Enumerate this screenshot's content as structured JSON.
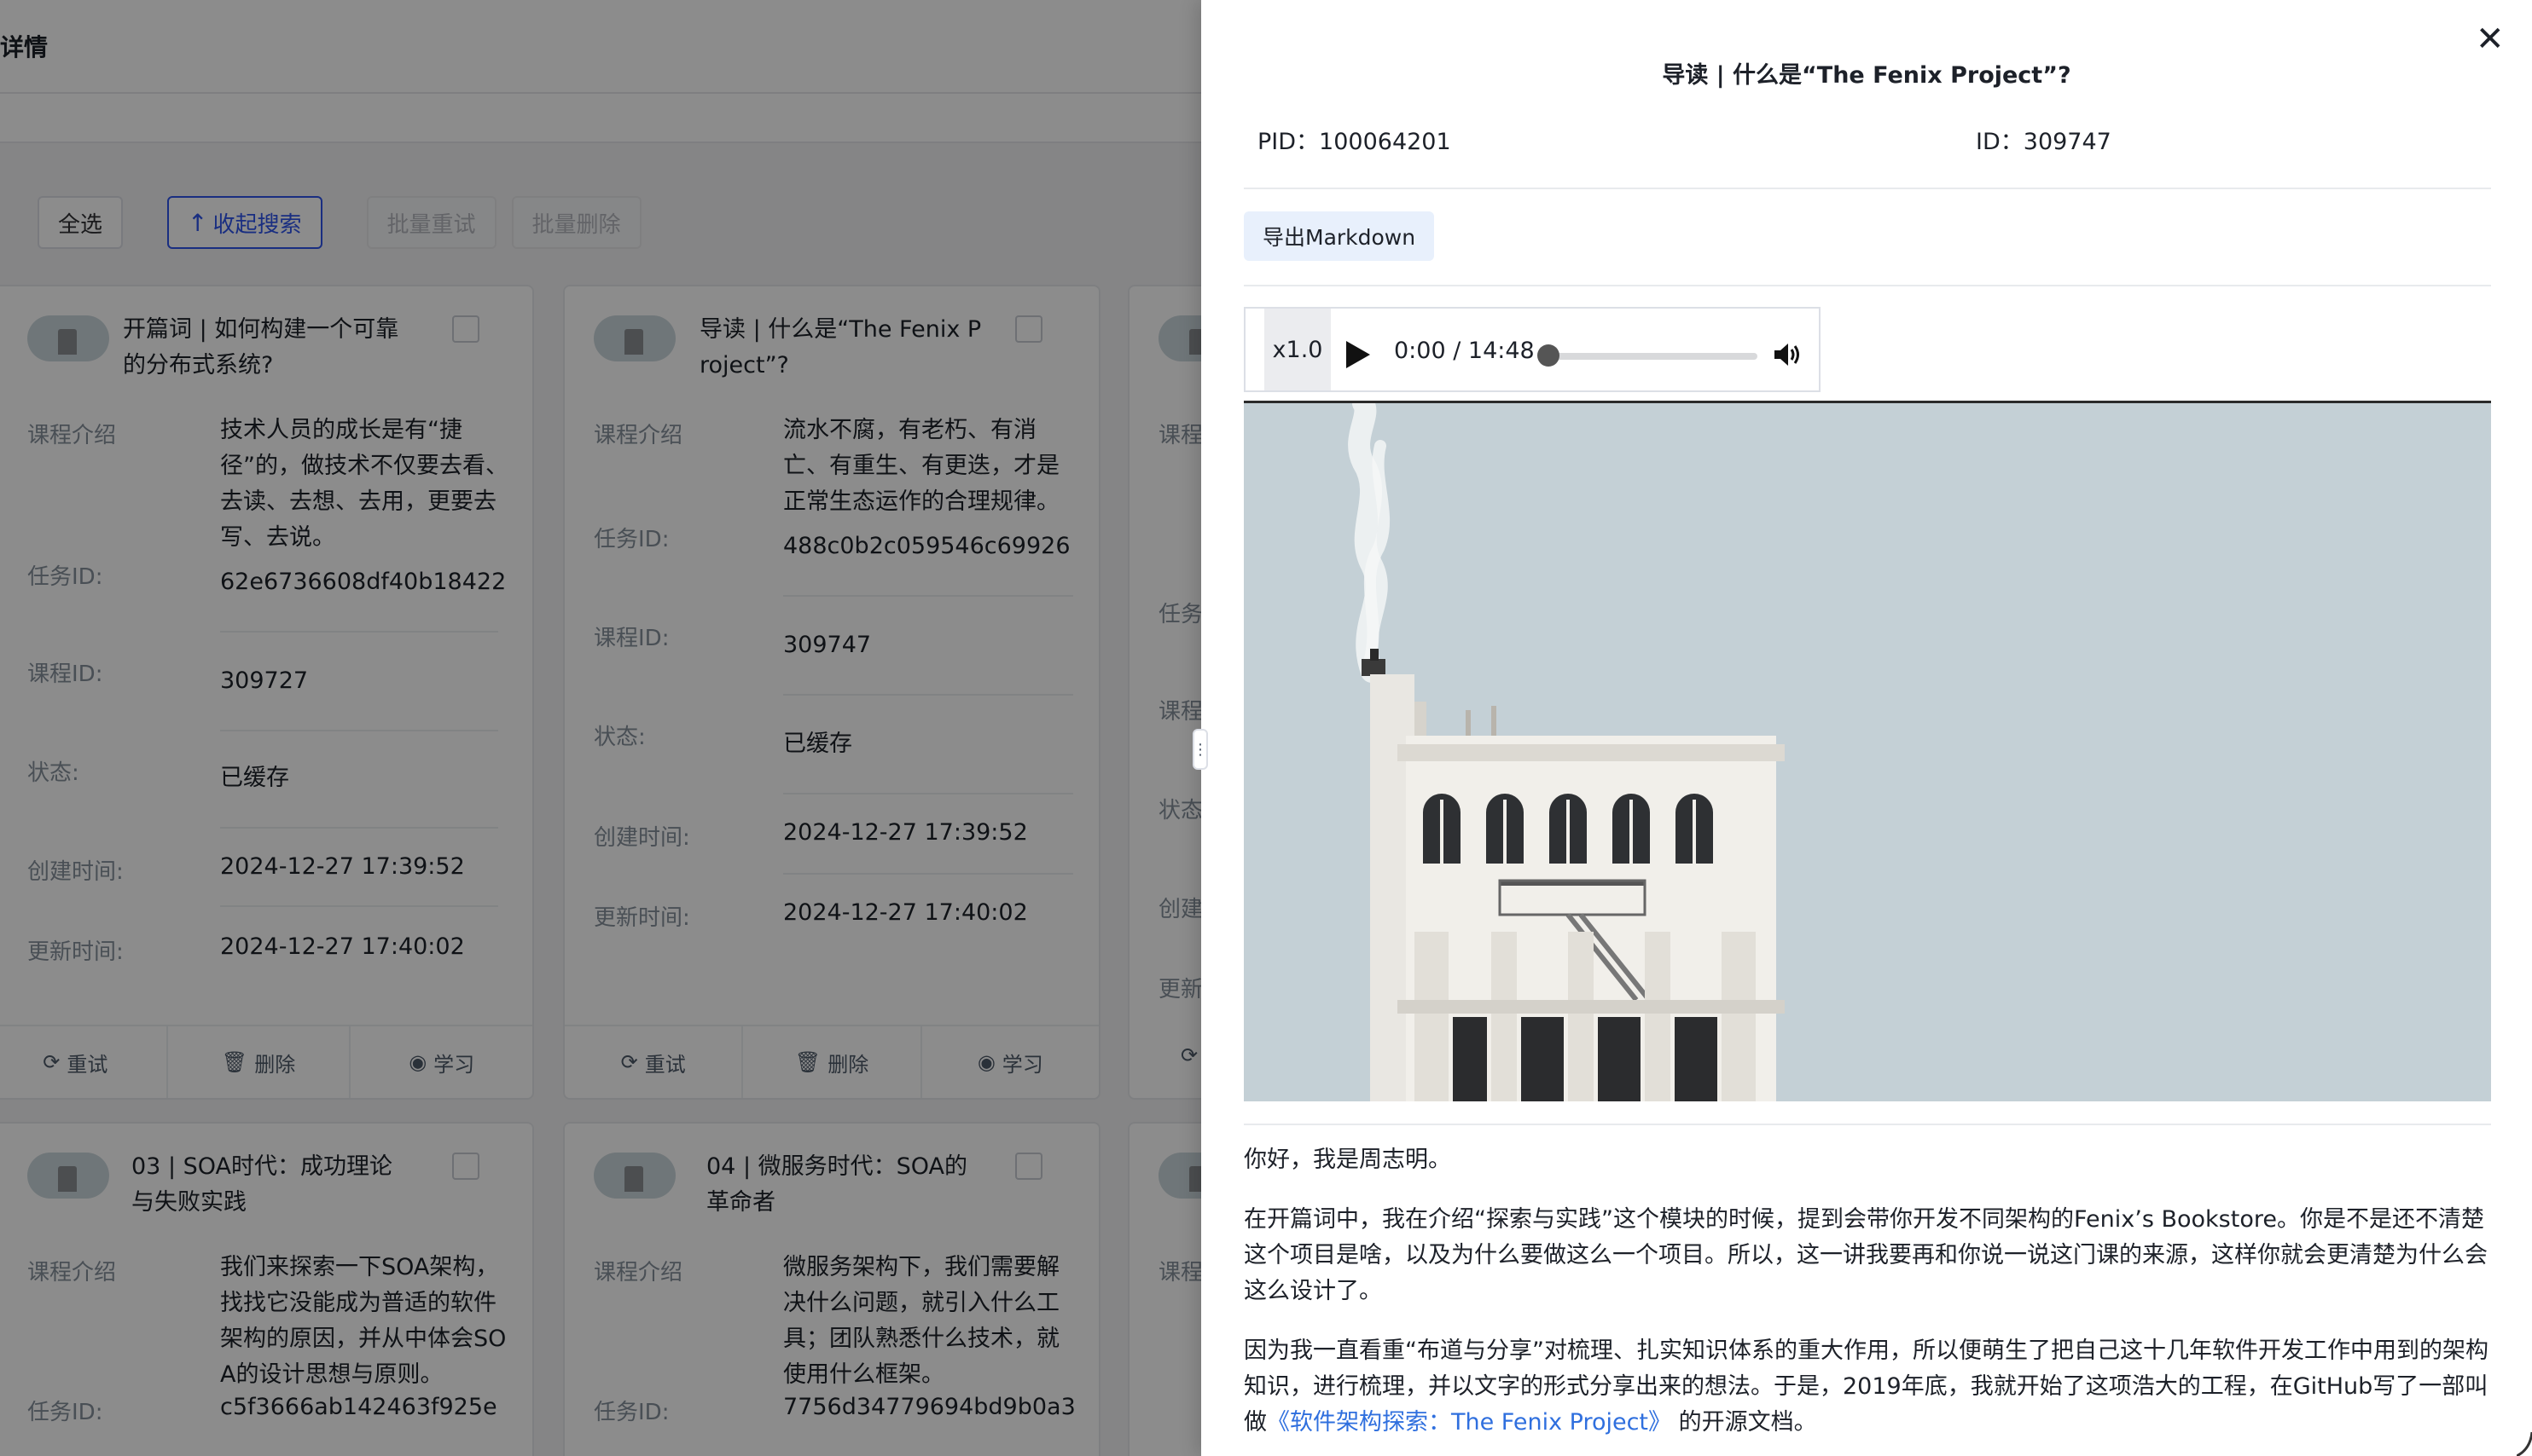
{
  "background": {
    "page_title": "详情",
    "toolbar": {
      "select_all": "全选",
      "collapse_search": "收起搜索",
      "batch_retry": "批量重试",
      "batch_delete": "批量删除"
    },
    "field_labels": {
      "intro": "课程介绍",
      "task_id": "任务ID:",
      "course_id": "课程ID:",
      "status": "状态:",
      "created": "创建时间:",
      "updated": "更新时间:"
    },
    "actions": {
      "retry": "重试",
      "delete": "删除",
      "learn": "学习"
    },
    "cards": [
      {
        "title": "开篇词 | 如何构建一个可靠的分布式系统?",
        "intro": "技术人员的成长是有“捷径”的，做技术不仅要去看、去读、去想、去用，更要去写、去说。",
        "task_id": "62e6736608df40b18422",
        "course_id": "309727",
        "status": "已缓存",
        "created": "2024-12-27 17:39:52",
        "updated": "2024-12-27 17:40:02"
      },
      {
        "title": "导读 | 什么是“The Fenix Project”?",
        "intro": "流水不腐，有老朽、有消亡、有重生、有更迭，才是正常生态运作的合理规律。",
        "task_id": "488c0b2c059546c69926",
        "course_id": "309747",
        "status": "已缓存",
        "created": "2024-12-27 17:39:52",
        "updated": "2024-12-27 17:40:02"
      },
      {
        "title": "03 | SOA时代：成功理论与失败实践",
        "intro": "我们来探索一下SOA架构，找找它没能成为普适的软件架构的原因，并从中体会SOA的设计思想与原则。",
        "task_id": "c5f3666ab142463f925e"
      },
      {
        "title": "04 | 微服务时代：SOA的革命者",
        "intro": "微服务架构下，我们需要解决什么问题，就引入什么工具；团队熟悉什么技术，就使用什么框架。",
        "task_id": "7756d34779694bd9b0a3"
      }
    ],
    "partial_column_labels": [
      "课程",
      "任务",
      "课程",
      "状态",
      "创建",
      "更新",
      "课程"
    ]
  },
  "drawer": {
    "title": "导读 | 什么是“The Fenix Project”?",
    "pid_label": "PID：",
    "pid": "100064201",
    "id_label": "ID：",
    "id": "309747",
    "export_button": "导出Markdown",
    "player": {
      "speed": "x1.0",
      "time": "0:00 / 14:48",
      "progress": 0
    },
    "article": {
      "p1": "你好，我是周志明。",
      "p2": "在开篇词中，我在介绍“探索与实践”这个模块的时候，提到会带你开发不同架构的Fenix’s Bookstore。你是不是还不清楚这个项目是啥，以及为什么要做这么一个项目。所以，这一讲我要再和你说一说这门课的来源，这样你就会更清楚为什么会这么设计了。",
      "p3_start": "因为我一直看重“布道与分享”对梳理、扎实知识体系的重大作用，所以便萌生了把自己这十几年软件开发工作中用到的架构知识，进行梳理，并以文字的形式分享出来的想法。于是，2019年底，我就开始了这项浩大的工程，在GitHub写了一部叫做",
      "p3_link": "《软件架构探索：The Fenix Project》",
      "p3_end": " 的开源文档。"
    }
  },
  "icons": {
    "close": "close-icon",
    "play": "play-icon",
    "volume": "volume-icon",
    "retry": "refresh-icon",
    "delete": "trash-icon",
    "learn": "eye-icon",
    "collapse": "arrow-up-icon"
  },
  "colors": {
    "primary": "#2f54eb",
    "link": "#2f6fde",
    "export_bg": "#e8f0fc",
    "mask": "rgba(0,0,0,0.45)"
  }
}
